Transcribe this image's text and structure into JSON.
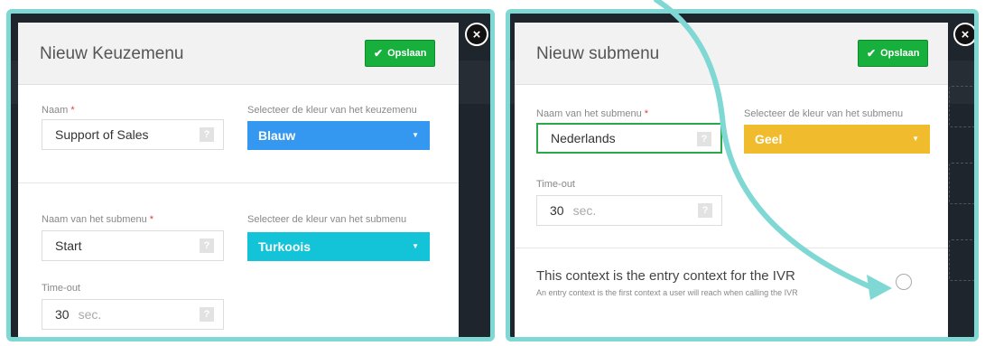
{
  "left_modal": {
    "title": "Nieuw Keuzemenu",
    "save_label": "Opslaan",
    "name_label": "Naam",
    "name_value": "Support of Sales",
    "menu_color_label": "Selecteer de kleur van het keuzemenu",
    "menu_color_value": "Blauw",
    "menu_color_hex": "#3498f0",
    "submenu_name_label": "Naam van het submenu",
    "submenu_name_value": "Start",
    "submenu_color_label": "Selecteer de kleur van het submenu",
    "submenu_color_value": "Turkoois",
    "submenu_color_hex": "#13c4d8",
    "timeout_label": "Time-out",
    "timeout_value": "30",
    "timeout_unit": "sec."
  },
  "right_modal": {
    "title": "Nieuw submenu",
    "save_label": "Opslaan",
    "submenu_name_label": "Naam van het submenu",
    "submenu_name_value": "Nederlands",
    "submenu_color_label": "Selecteer de kleur van het submenu",
    "submenu_color_value": "Geel",
    "submenu_color_hex": "#f0bc2d",
    "timeout_label": "Time-out",
    "timeout_value": "30",
    "timeout_unit": "sec.",
    "entry_title": "This context is the entry context for the IVR",
    "entry_description": "An entry context is the first context a user will reach when calling the IVR",
    "entry_checked": false
  },
  "common": {
    "required_mark": "*",
    "help_mark": "?",
    "close_mark": "×",
    "check_mark": "✔",
    "caret_mark": "▼"
  },
  "colors": {
    "highlight_border": "#7fd8d3",
    "save_green": "#17b03c",
    "arrow": "#7fd8d3"
  },
  "icons": [
    "close-icon",
    "check-icon",
    "help-icon",
    "caret-down-icon",
    "radio-icon"
  ]
}
